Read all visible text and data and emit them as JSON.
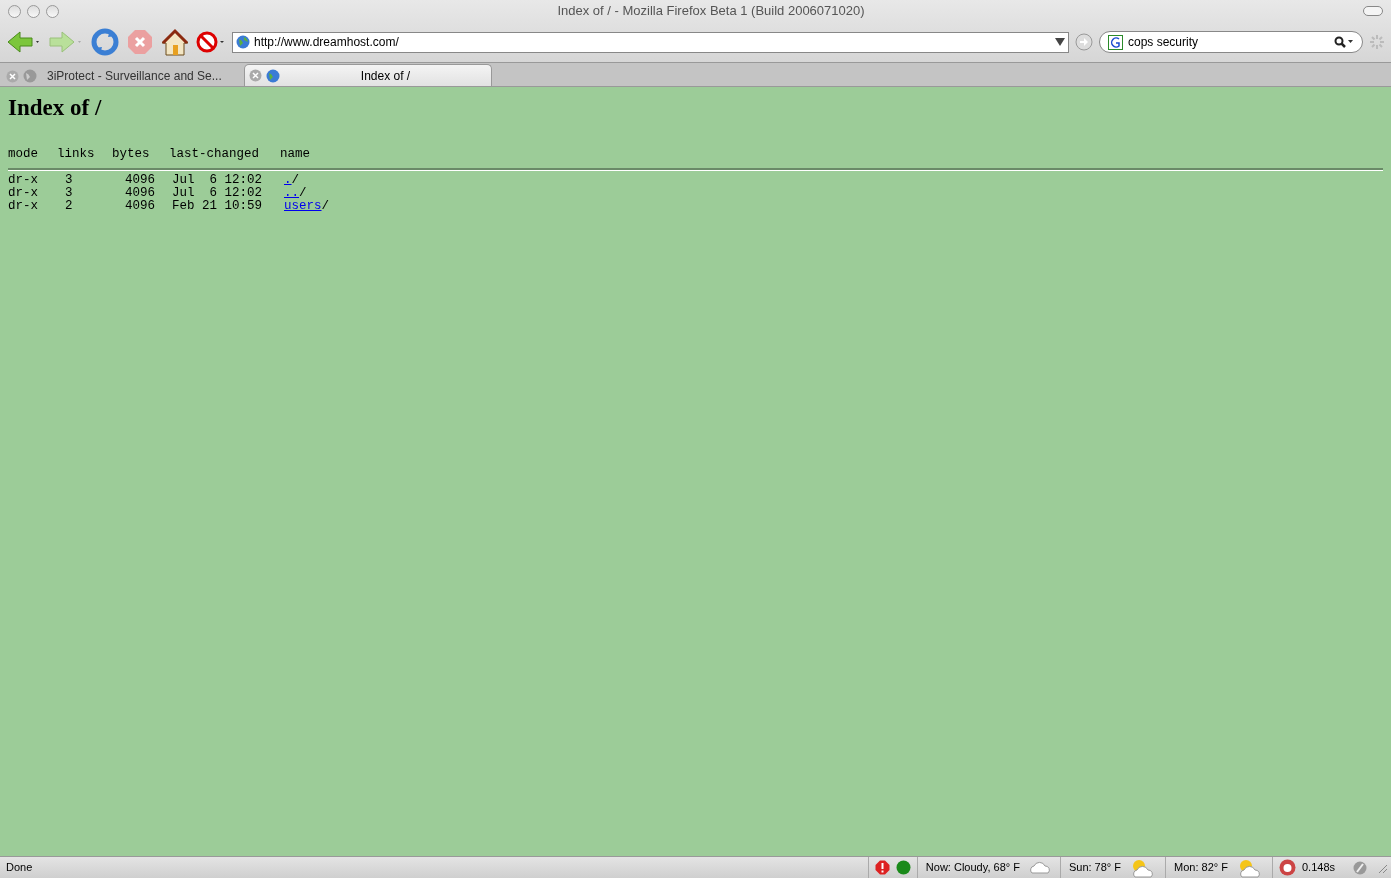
{
  "window": {
    "title": "Index of / - Mozilla Firefox Beta 1 (Build 2006071020)"
  },
  "toolbar": {
    "url": "http://www.dreamhost.com/",
    "search": "cops security"
  },
  "tabs": [
    {
      "label": "3iProtect - Surveillance and Se...",
      "selected": false
    },
    {
      "label": "Index of /",
      "selected": true
    }
  ],
  "page": {
    "heading": "Index of /",
    "columns": [
      "mode",
      "links",
      "bytes",
      "last-changed",
      "name"
    ],
    "rows": [
      {
        "mode": "dr-x",
        "links": "3",
        "bytes": "4096",
        "last_changed": "Jul  6 12:02",
        "name": "./"
      },
      {
        "mode": "dr-x",
        "links": "3",
        "bytes": "4096",
        "last_changed": "Jul  6 12:02",
        "name": "../"
      },
      {
        "mode": "dr-x",
        "links": "2",
        "bytes": "4096",
        "last_changed": "Feb 21 10:59",
        "name": "users/"
      }
    ]
  },
  "status_bar": {
    "status": "Done",
    "weather": [
      "Now: Cloudy, 68° F",
      "Sun: 78° F",
      "Mon: 82° F"
    ],
    "timer": "0.148s"
  }
}
